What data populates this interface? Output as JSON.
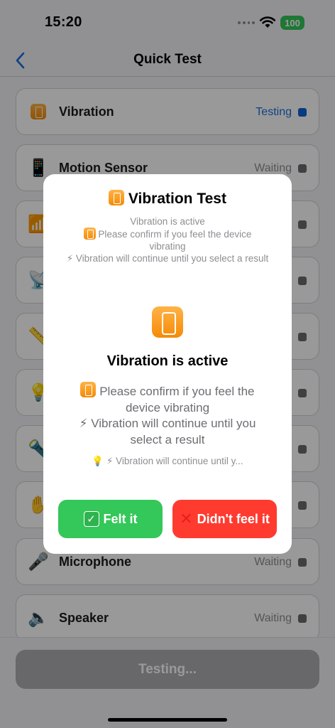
{
  "status_bar": {
    "time": "15:20",
    "battery": "100"
  },
  "nav": {
    "title": "Quick Test"
  },
  "tests": [
    {
      "icon": "vibration-icon",
      "glyph": "",
      "label": "Vibration",
      "status": "Testing",
      "active": true
    },
    {
      "icon": "phone-icon",
      "glyph": "📱",
      "label": "Motion Sensor",
      "status": "Waiting",
      "active": false
    },
    {
      "icon": "bars-icon",
      "glyph": "📶",
      "label": "",
      "status": "",
      "active": false
    },
    {
      "icon": "satellite-icon",
      "glyph": "📡",
      "label": "",
      "status": "",
      "active": false
    },
    {
      "icon": "ruler-icon",
      "glyph": "📏",
      "label": "",
      "status": "",
      "active": false
    },
    {
      "icon": "bulb-icon",
      "glyph": "💡",
      "label": "",
      "status": "",
      "active": false
    },
    {
      "icon": "flashlight-icon",
      "glyph": "🔦",
      "label": "",
      "status": "",
      "active": false
    },
    {
      "icon": "hand-icon",
      "glyph": "✋",
      "label": "",
      "status": "",
      "active": false
    },
    {
      "icon": "microphone-icon",
      "glyph": "🎤",
      "label": "Microphone",
      "status": "Waiting",
      "active": false
    },
    {
      "icon": "speaker-icon",
      "glyph": "🔈",
      "label": "Speaker",
      "status": "Waiting",
      "active": false
    }
  ],
  "bottom": {
    "button_label": "Testing..."
  },
  "modal": {
    "title": "Vibration Test",
    "small_line1": "Vibration is active",
    "small_line2": "Please confirm if you feel the device vibrating",
    "small_line3": "⚡ Vibration will continue until you select a result",
    "heading": "Vibration is active",
    "body_line1": "Please confirm if you feel the device vibrating",
    "body_line2": "⚡ Vibration will continue until you select a result",
    "hint": "💡 ⚡ Vibration will continue until y...",
    "felt_label": "Felt it",
    "not_felt_label": "Didn't feel it"
  },
  "colors": {
    "accent": "#1a6ed8",
    "success": "#34c759",
    "danger": "#ff3b30"
  }
}
